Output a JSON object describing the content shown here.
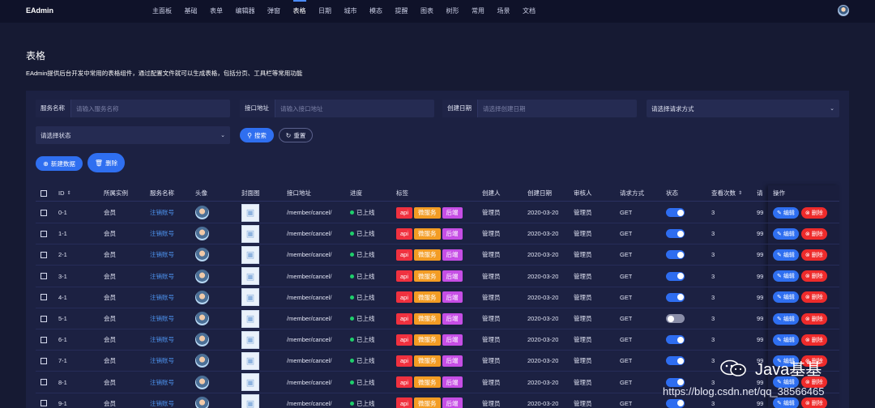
{
  "app": {
    "brand": "EAdmin"
  },
  "nav": [
    "主面板",
    "基础",
    "表单",
    "编辑器",
    "弹窗",
    "表格",
    "日期",
    "城市",
    "模态",
    "提醒",
    "图表",
    "树形",
    "常用",
    "场景",
    "文档"
  ],
  "nav_active_index": 5,
  "page": {
    "title": "表格",
    "description": "EAdmin提供后台开发中常用的表格组件，通过配置文件就可以生成表格，包括分页、工具栏等常用功能"
  },
  "filters": {
    "service_name": {
      "label": "服务名称",
      "placeholder": "请输入服务名称"
    },
    "api_address": {
      "label": "接口地址",
      "placeholder": "请输入接口地址"
    },
    "create_date": {
      "label": "创建日期",
      "placeholder": "请选择创建日期"
    },
    "request_method": {
      "placeholder": "请选择请求方式"
    },
    "status": {
      "placeholder": "请选择状态"
    }
  },
  "buttons": {
    "search": "搜索",
    "reset": "重置",
    "create": "新建数据",
    "delete": "删除"
  },
  "columns": [
    "ID",
    "所属实例",
    "服务名称",
    "头像",
    "封面图",
    "接口地址",
    "进度",
    "标签",
    "创建人",
    "创建日期",
    "审核人",
    "请求方式",
    "状态",
    "查看次数",
    "请",
    "操作"
  ],
  "tags": [
    "api",
    "微服务",
    "后端"
  ],
  "row_actions": {
    "edit": "编辑",
    "delete": "删除"
  },
  "rows": [
    {
      "id": "0-1",
      "instance": "会员",
      "service": "注销账号",
      "api": "/member/cancel/",
      "progress": "已上线",
      "creator": "管理员",
      "date": "2020-03-20",
      "reviewer": "管理员",
      "method": "GET",
      "status_on": true,
      "views": "3",
      "extra": "99"
    },
    {
      "id": "1-1",
      "instance": "会员",
      "service": "注销账号",
      "api": "/member/cancel/",
      "progress": "已上线",
      "creator": "管理员",
      "date": "2020-03-20",
      "reviewer": "管理员",
      "method": "GET",
      "status_on": true,
      "views": "3",
      "extra": "99"
    },
    {
      "id": "2-1",
      "instance": "会员",
      "service": "注销账号",
      "api": "/member/cancel/",
      "progress": "已上线",
      "creator": "管理员",
      "date": "2020-03-20",
      "reviewer": "管理员",
      "method": "GET",
      "status_on": true,
      "views": "3",
      "extra": "99"
    },
    {
      "id": "3-1",
      "instance": "会员",
      "service": "注销账号",
      "api": "/member/cancel/",
      "progress": "已上线",
      "creator": "管理员",
      "date": "2020-03-20",
      "reviewer": "管理员",
      "method": "GET",
      "status_on": true,
      "views": "3",
      "extra": "99"
    },
    {
      "id": "4-1",
      "instance": "会员",
      "service": "注销账号",
      "api": "/member/cancel/",
      "progress": "已上线",
      "creator": "管理员",
      "date": "2020-03-20",
      "reviewer": "管理员",
      "method": "GET",
      "status_on": true,
      "views": "3",
      "extra": "99"
    },
    {
      "id": "5-1",
      "instance": "会员",
      "service": "注销账号",
      "api": "/member/cancel/",
      "progress": "已上线",
      "creator": "管理员",
      "date": "2020-03-20",
      "reviewer": "管理员",
      "method": "GET",
      "status_on": false,
      "views": "3",
      "extra": "99"
    },
    {
      "id": "6-1",
      "instance": "会员",
      "service": "注销账号",
      "api": "/member/cancel/",
      "progress": "已上线",
      "creator": "管理员",
      "date": "2020-03-20",
      "reviewer": "管理员",
      "method": "GET",
      "status_on": true,
      "views": "3",
      "extra": "99"
    },
    {
      "id": "7-1",
      "instance": "会员",
      "service": "注销账号",
      "api": "/member/cancel/",
      "progress": "已上线",
      "creator": "管理员",
      "date": "2020-03-20",
      "reviewer": "管理员",
      "method": "GET",
      "status_on": true,
      "views": "3",
      "extra": "99"
    },
    {
      "id": "8-1",
      "instance": "会员",
      "service": "注销账号",
      "api": "/member/cancel/",
      "progress": "已上线",
      "creator": "管理员",
      "date": "2020-03-20",
      "reviewer": "管理员",
      "method": "GET",
      "status_on": true,
      "views": "3",
      "extra": "99"
    },
    {
      "id": "9-1",
      "instance": "会员",
      "service": "注销账号",
      "api": "/member/cancel/",
      "progress": "已上线",
      "creator": "管理员",
      "date": "2020-03-20",
      "reviewer": "管理员",
      "method": "GET",
      "status_on": true,
      "views": "3",
      "extra": "99"
    }
  ],
  "watermark": {
    "line1": "Java基基",
    "line2": "https://blog.csdn.net/qq_38566465"
  },
  "colors": {
    "background": "#161a33",
    "topbar": "#0f1229",
    "primary": "#2f6ff0",
    "danger": "#ee2b2b",
    "online": "#1fcf6b"
  }
}
